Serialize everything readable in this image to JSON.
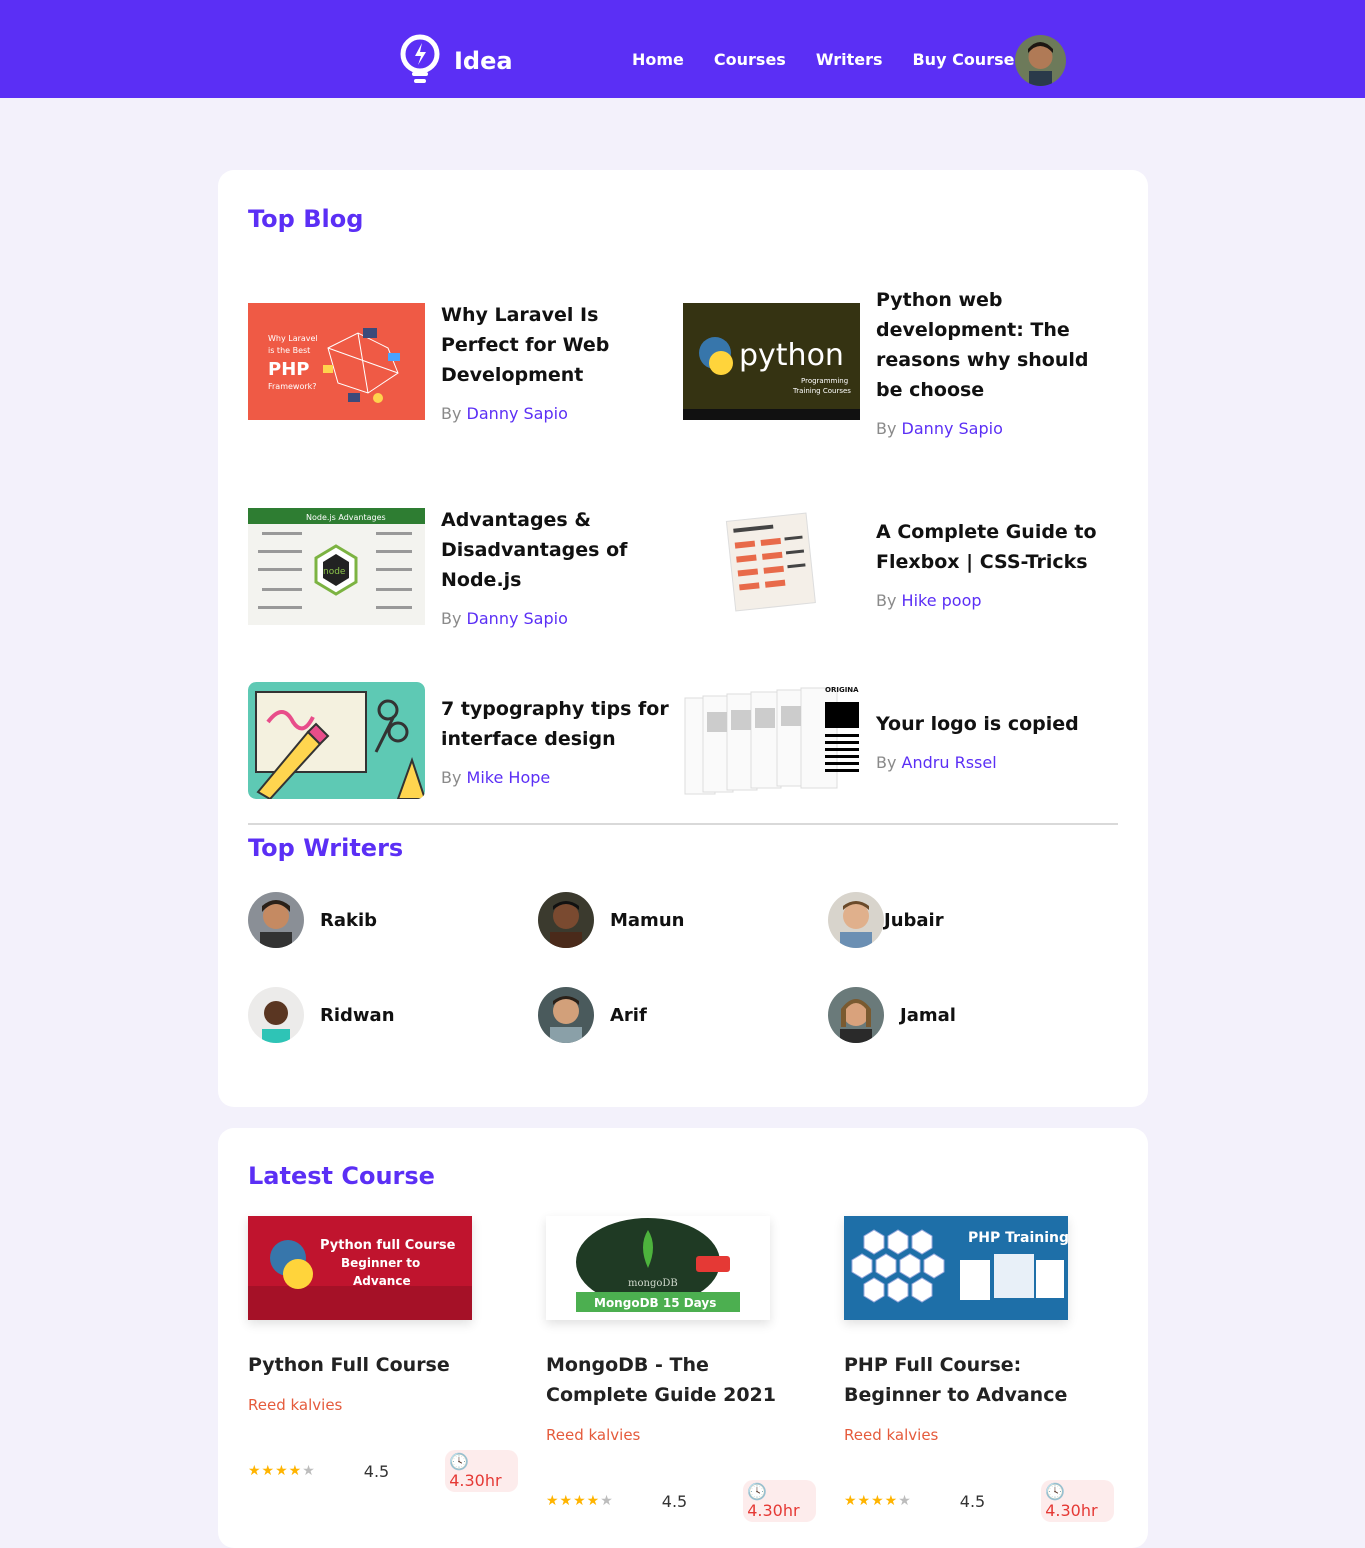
{
  "header": {
    "brand": "Idea",
    "nav": [
      "Home",
      "Courses",
      "Writers",
      "Buy Course"
    ]
  },
  "top_blog": {
    "title": "Top Blog",
    "by_label": "By",
    "posts": [
      {
        "title": "Why Laravel Is Perfect for Web Development",
        "author": "Danny Sapio"
      },
      {
        "title": "Python web development: The reasons why should be choose",
        "author": "Danny Sapio"
      },
      {
        "title": "Advantages & Disadvantages of Node.js",
        "author": "Danny Sapio"
      },
      {
        "title": "A Complete Guide to Flexbox | CSS-Tricks",
        "author": "Hike poop"
      },
      {
        "title": "7 typography tips for interface design",
        "author": "Mike Hope"
      },
      {
        "title": "Your logo is copied",
        "author": "Andru Rssel"
      }
    ]
  },
  "top_writers": {
    "title": "Top Writers",
    "writers": [
      "Rakib",
      "Mamun",
      "Jubair",
      "Ridwan",
      "Arif",
      "Jamal"
    ]
  },
  "latest_course": {
    "title": "Latest Course",
    "courses": [
      {
        "title": "Python Full Course",
        "author": "Reed kalvies",
        "rating": "4.5",
        "stars": 4,
        "duration": "4.30hr"
      },
      {
        "title": "MongoDB - The Complete Guide 2021",
        "author": "Reed kalvies",
        "rating": "4.5",
        "stars": 4,
        "duration": "4.30hr"
      },
      {
        "title": "PHP Full Course: Beginner to Advance",
        "author": "Reed kalvies",
        "rating": "4.5",
        "stars": 4,
        "duration": "4.30hr"
      }
    ]
  },
  "thumb_text": {
    "laravel": [
      "Why Laravel",
      "is the Best",
      "PHP",
      "Framework?"
    ],
    "python": "python",
    "python_sub": [
      "Programming",
      "Training Courses"
    ],
    "node": "Node.js Advantages",
    "node_logo": "node",
    "original": "ORIGINA",
    "course_python": [
      "Python full Course",
      "Beginner to",
      "Advance"
    ],
    "course_mongo": "MongoDB 15 Days",
    "course_mongo_logo": "mongoDB",
    "course_php": "PHP Training"
  },
  "colors": {
    "brand": "#5b2ff5",
    "accent_red": "#e55b3c",
    "star": "#ffb400"
  }
}
